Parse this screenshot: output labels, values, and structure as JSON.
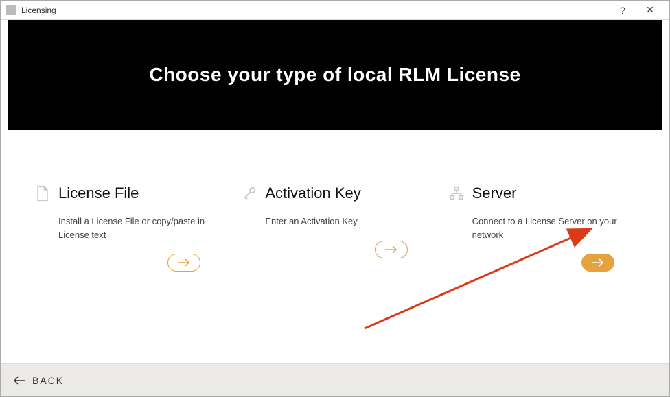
{
  "window": {
    "title": "Licensing",
    "help": "?",
    "close": "✕"
  },
  "header": {
    "heading": "Choose your type of local RLM License"
  },
  "options": [
    {
      "icon": "file-icon",
      "title": "License File",
      "description": "Install a License File or copy/paste in License text",
      "selected": false
    },
    {
      "icon": "key-icon",
      "title": "Activation Key",
      "description": "Enter an Activation Key",
      "selected": false
    },
    {
      "icon": "network-icon",
      "title": "Server",
      "description": "Connect to a License Server on your network",
      "selected": true
    }
  ],
  "footer": {
    "back_label": "BACK"
  }
}
